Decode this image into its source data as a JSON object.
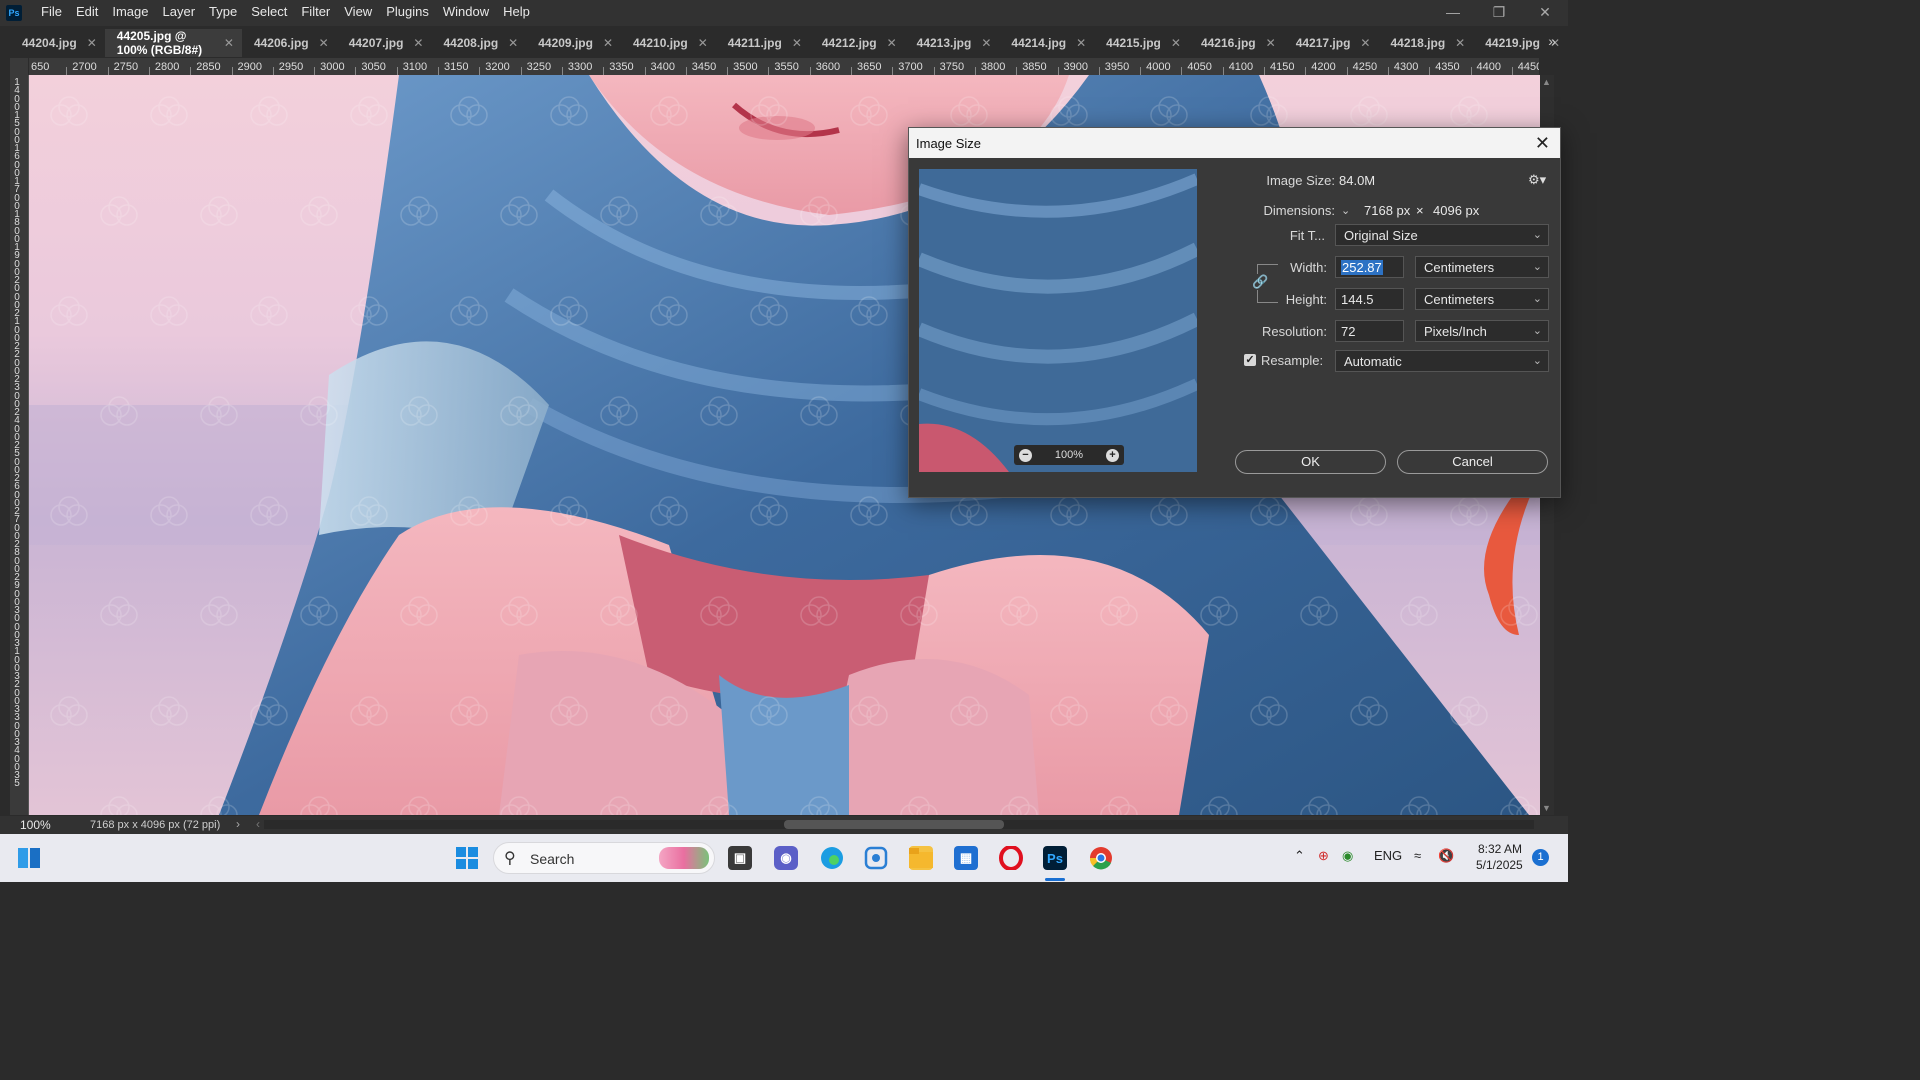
{
  "menu": {
    "app_icon": "Ps",
    "items": [
      "File",
      "Edit",
      "Image",
      "Layer",
      "Type",
      "Select",
      "Filter",
      "View",
      "Plugins",
      "Window",
      "Help"
    ]
  },
  "tabs": [
    {
      "label": "44204.jpg",
      "active": false
    },
    {
      "label": "44205.jpg @ 100% (RGB/8#)",
      "active": true
    },
    {
      "label": "44206.jpg",
      "active": false
    },
    {
      "label": "44207.jpg",
      "active": false
    },
    {
      "label": "44208.jpg",
      "active": false
    },
    {
      "label": "44209.jpg",
      "active": false
    },
    {
      "label": "44210.jpg",
      "active": false
    },
    {
      "label": "44211.jpg",
      "active": false
    },
    {
      "label": "44212.jpg",
      "active": false
    },
    {
      "label": "44213.jpg",
      "active": false
    },
    {
      "label": "44214.jpg",
      "active": false
    },
    {
      "label": "44215.jpg",
      "active": false
    },
    {
      "label": "44216.jpg",
      "active": false
    },
    {
      "label": "44217.jpg",
      "active": false
    },
    {
      "label": "44218.jpg",
      "active": false
    },
    {
      "label": "44219.jpg",
      "active": false
    }
  ],
  "ruler_h": [
    "650",
    "2700",
    "2750",
    "2800",
    "2850",
    "2900",
    "2950",
    "3000",
    "3050",
    "3100",
    "3150",
    "3200",
    "3250",
    "3300",
    "3350",
    "3400",
    "3450",
    "3500",
    "3550",
    "3600",
    "3650",
    "3700",
    "3750",
    "3800",
    "3850",
    "3900",
    "3950",
    "4000",
    "4050",
    "4100",
    "4150",
    "4200",
    "4250",
    "4300",
    "4350",
    "4400",
    "4450",
    "4"
  ],
  "ruler_v": [
    "1",
    "4",
    "0",
    "0",
    "1",
    "5",
    "0",
    "0",
    "1",
    "6",
    "0",
    "0",
    "1",
    "7",
    "0",
    "0",
    "1",
    "8",
    "0",
    "0",
    "1",
    "9",
    "0",
    "0",
    "2",
    "0",
    "0",
    "0",
    "2",
    "1",
    "0",
    "0",
    "2",
    "2",
    "0",
    "0",
    "2",
    "3",
    "0",
    "0",
    "2",
    "4",
    "0",
    "0",
    "2",
    "5",
    "0",
    "0",
    "2",
    "6",
    "0",
    "0",
    "2",
    "7",
    "0",
    "0",
    "2",
    "8",
    "0",
    "0",
    "2",
    "9",
    "0",
    "0",
    "3",
    "0",
    "0",
    "0",
    "3",
    "1",
    "0",
    "0",
    "3",
    "2",
    "0",
    "0",
    "3",
    "3",
    "0",
    "0",
    "3",
    "4",
    "0",
    "0",
    "3",
    "5"
  ],
  "watermark": "Aatrash.ir",
  "status": {
    "zoom": "100%",
    "doc_info": "7168 px x 4096 px (72 ppi)"
  },
  "dialog": {
    "title": "Image Size",
    "preview_zoom": "100%",
    "image_size_label": "Image Size:",
    "image_size_value": "84.0M",
    "dimensions_label": "Dimensions:",
    "dim_width": "7168 px",
    "dim_sep": "×",
    "dim_height": "4096 px",
    "fit_label": "Fit T...",
    "fit_value": "Original Size",
    "width_label": "Width:",
    "width_value": "252.87",
    "width_unit": "Centimeters",
    "height_label": "Height:",
    "height_value": "144.5",
    "height_unit": "Centimeters",
    "resolution_label": "Resolution:",
    "resolution_value": "72",
    "resolution_unit": "Pixels/Inch",
    "resample_label": "Resample:",
    "resample_checked": true,
    "resample_value": "Automatic",
    "ok_label": "OK",
    "cancel_label": "Cancel"
  },
  "taskbar": {
    "search_label": "Search",
    "language": "ENG",
    "time": "8:32 AM",
    "date": "5/1/2025",
    "notification_count": "1"
  }
}
